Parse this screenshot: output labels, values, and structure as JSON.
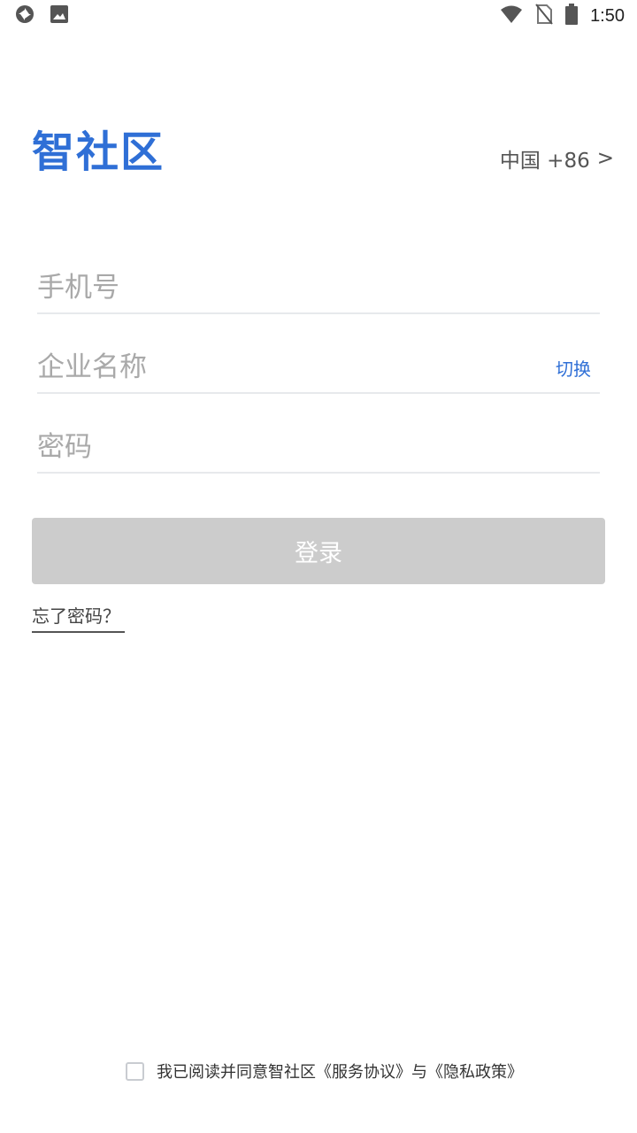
{
  "status_bar": {
    "time": "1:50",
    "left_icons": [
      "sync-icon",
      "image-icon"
    ],
    "right_icons": [
      "wifi-icon",
      "no-sim-icon",
      "battery-icon"
    ]
  },
  "header": {
    "logo_text": "智社区",
    "country_code_label": "中国 +86",
    "country_chevron": ">"
  },
  "form": {
    "phone_placeholder": "手机号",
    "company_placeholder": "企业名称",
    "company_switch_label": "切换",
    "password_placeholder": "密码",
    "login_label": "登录",
    "forgot_password_label": "忘了密码？"
  },
  "agreement": {
    "text": "我已阅读并同意智社区《服务协议》与《隐私政策》",
    "checked": false
  },
  "colors": {
    "brand": "#2f6fd6",
    "disabled_button": "#cccccc",
    "divider": "#e7e9ec"
  }
}
